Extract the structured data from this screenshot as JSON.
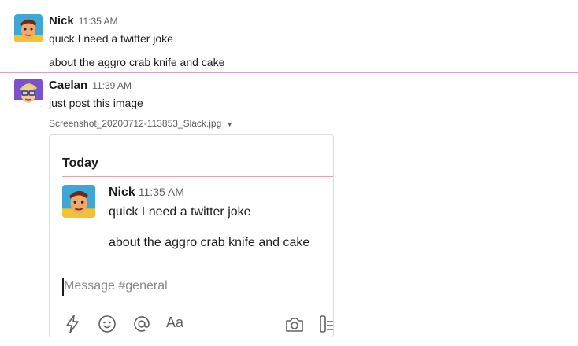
{
  "messages": [
    {
      "author": "Nick",
      "time": "11:35 AM",
      "lines": [
        "quick I need a twitter joke",
        "about the aggro crab knife and cake"
      ]
    },
    {
      "author": "Caelan",
      "time": "11:39 AM",
      "lines": [
        "just post this image"
      ],
      "file": {
        "name": "Screenshot_20200712-113853_Slack.jpg"
      }
    }
  ],
  "screenshot": {
    "day_divider": "Today",
    "author": "Nick",
    "time": "11:35 AM",
    "lines": [
      "quick I need a twitter joke",
      "about the aggro crab knife and cake"
    ],
    "composer_placeholder": "Message #general",
    "format_label": "Aa"
  },
  "icons": {
    "caret": "chevron-down-icon",
    "toolbar": [
      "lightning-icon",
      "emoji-icon",
      "mention-icon",
      "camera-icon",
      "attach-icon"
    ]
  },
  "colors": {
    "new_divider": "#d4a2d8",
    "today_line": "#e8a0aa"
  }
}
